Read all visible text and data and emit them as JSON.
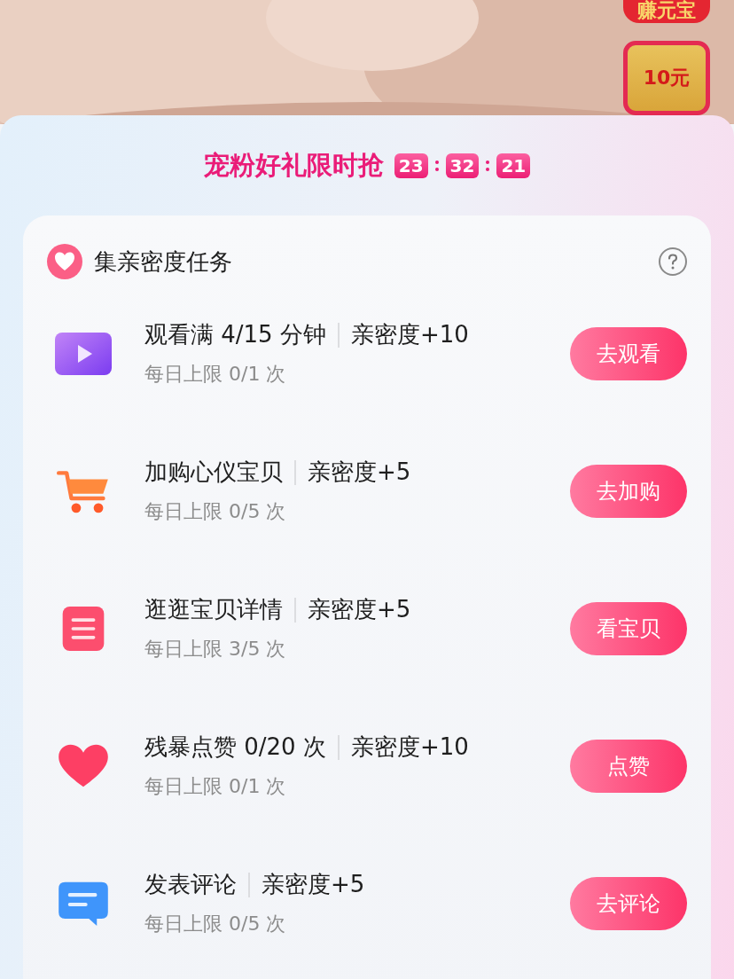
{
  "badges": [
    {
      "label": "赚元宝"
    },
    {
      "label": "10元"
    }
  ],
  "banner": {
    "title": "宠粉好礼限时抢",
    "countdown": [
      "23",
      "32",
      "21"
    ]
  },
  "task_card": {
    "title": "集亲密度任务",
    "tasks": [
      {
        "kind": "video",
        "title": "观看满 4/15 分钟",
        "reward": "亲密度+10",
        "limit": "每日上限 0/1 次",
        "button": "去观看"
      },
      {
        "kind": "cart",
        "title": "加购心仪宝贝",
        "reward": "亲密度+5",
        "limit": "每日上限 0/5 次",
        "button": "去加购"
      },
      {
        "kind": "list",
        "title": "逛逛宝贝详情",
        "reward": "亲密度+5",
        "limit": "每日上限 3/5 次",
        "button": "看宝贝"
      },
      {
        "kind": "heart",
        "title": "残暴点赞 0/20 次",
        "reward": "亲密度+10",
        "limit": "每日上限 0/1 次",
        "button": "点赞"
      },
      {
        "kind": "comment",
        "title": "发表评论",
        "reward": "亲密度+5",
        "limit": "每日上限 0/5 次",
        "button": "去评论"
      }
    ]
  }
}
